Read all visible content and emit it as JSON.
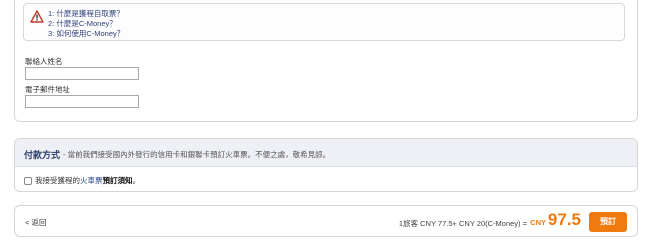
{
  "faq": {
    "items": [
      "1: 什麼是獲程自取票？",
      "2: 什麼是C-Money？",
      "3: 如何使用C-Money？"
    ]
  },
  "contact": {
    "name_label": "聯絡人姓名",
    "name_value": "",
    "email_label": "電子郵件地址",
    "email_value": ""
  },
  "payment": {
    "title": "付款方式",
    "note": "- 當前我們接受國內外發行的信用卡和銀聯卡預訂火車票。不便之處，敬希見諒。",
    "checkbox_prefix": "我接受獲程的",
    "checkbox_link": "火車票",
    "checkbox_bold": "預訂須知",
    "checkbox_suffix": "。"
  },
  "footer": {
    "back_label": "< 返回",
    "price_breakdown": "1旅客 CNY 77.5+ CNY 20(C-Money) =",
    "currency": "CNY",
    "total": "97.5",
    "book_label": "預訂"
  },
  "colors": {
    "accent": "#f07a10",
    "header_bg": "#eef0f5",
    "title": "#2d3f6b",
    "faq_link": "#2d3f78"
  }
}
